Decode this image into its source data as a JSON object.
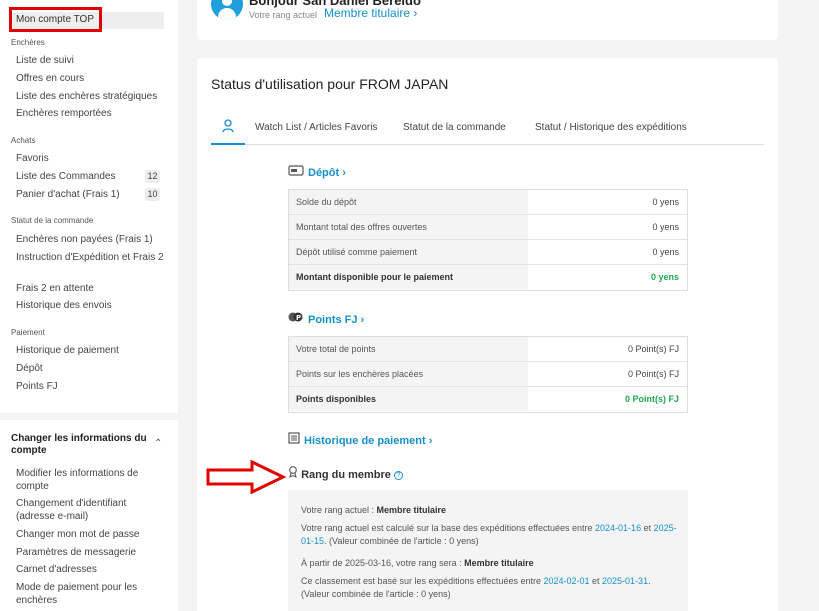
{
  "sidebar": {
    "top_link": "Mon compte TOP",
    "sections": [
      {
        "title": "Enchères",
        "items": [
          "Liste de suivi",
          "Offres en cours",
          "Liste des enchères stratégiques",
          "Enchères remportées"
        ]
      },
      {
        "title": "Achats",
        "items": [
          "Favoris",
          "Liste des Commandes",
          "Panier d'achat (Frais 1)"
        ]
      },
      {
        "title": "Statut de la commande",
        "items": [
          "Enchères non payées (Frais 1)",
          "Instruction d'Expédition et Frais 2",
          "Frais 2 en attente",
          "Historique des envois"
        ]
      },
      {
        "title": "Paiement",
        "items": [
          "Historique de paiement",
          "Dépôt",
          "Points FJ"
        ]
      }
    ],
    "badges": {
      "orders": "12",
      "cart": "10"
    },
    "account": {
      "title": "Changer les informations du compte",
      "items": [
        "Modifier les informations de compte",
        "Changement d'identifiant (adresse e-mail)",
        "Changer mon mot de passe",
        "Paramètres de messagerie",
        "Carnet d'adresses",
        "Mode de paiement pour les enchères"
      ]
    }
  },
  "header": {
    "greeting": "Bonjour San Daniel Bereido",
    "rank_label": "Votre rang actuel",
    "rank_value": "Membre titulaire ›"
  },
  "main": {
    "title": "Status d'utilisation pour FROM JAPAN",
    "tabs": [
      "Watch List / Articles Favoris",
      "Statut de la commande",
      "Statut / Historique des expéditions"
    ],
    "deposit": {
      "heading": "Dépôt ›",
      "rows": [
        {
          "label": "Solde du dépôt",
          "value": "0 yens"
        },
        {
          "label": "Montant total des offres ouvertes",
          "value": "0 yens"
        },
        {
          "label": "Dépôt utilisé comme paiement",
          "value": "0 yens"
        },
        {
          "label": "Montant disponible pour le paiement",
          "value": "0 yens"
        }
      ]
    },
    "points": {
      "heading": "Points FJ ›",
      "rows": [
        {
          "label": "Votre total de points",
          "value": "0 Point(s) FJ"
        },
        {
          "label": "Points sur les enchères placées",
          "value": "0 Point(s) FJ"
        },
        {
          "label": "Points disponibles",
          "value": "0 Point(s) FJ"
        }
      ]
    },
    "payment_history": "Historique de paiement ›",
    "rank": {
      "heading": "Rang du membre",
      "current_prefix": "Votre rang actuel : ",
      "current_value": "Membre titulaire",
      "calc_text": "Votre rang actuel est calculé sur la base des expéditions effectuées entre ",
      "calc_date1": "2024-01-16",
      "calc_mid": " et ",
      "calc_date2": "2025-01-15",
      "calc_suffix": ". (Valeur combinée de l'article : 0 yens)",
      "future_prefix": "À partir de 2025-03-16, votre rang sera : ",
      "future_value": "Membre titulaire",
      "based_text": "Ce classement est basé sur les expéditions effectuées entre ",
      "based_date1": "2024-02-01",
      "based_mid": " et ",
      "based_date2": "2025-01-31",
      "based_suffix": ". (Valeur combinée de l'article : 0 yens)"
    }
  },
  "colors": {
    "accent": "#1590c9",
    "highlight_red": "#e00000",
    "success": "#21a853"
  }
}
